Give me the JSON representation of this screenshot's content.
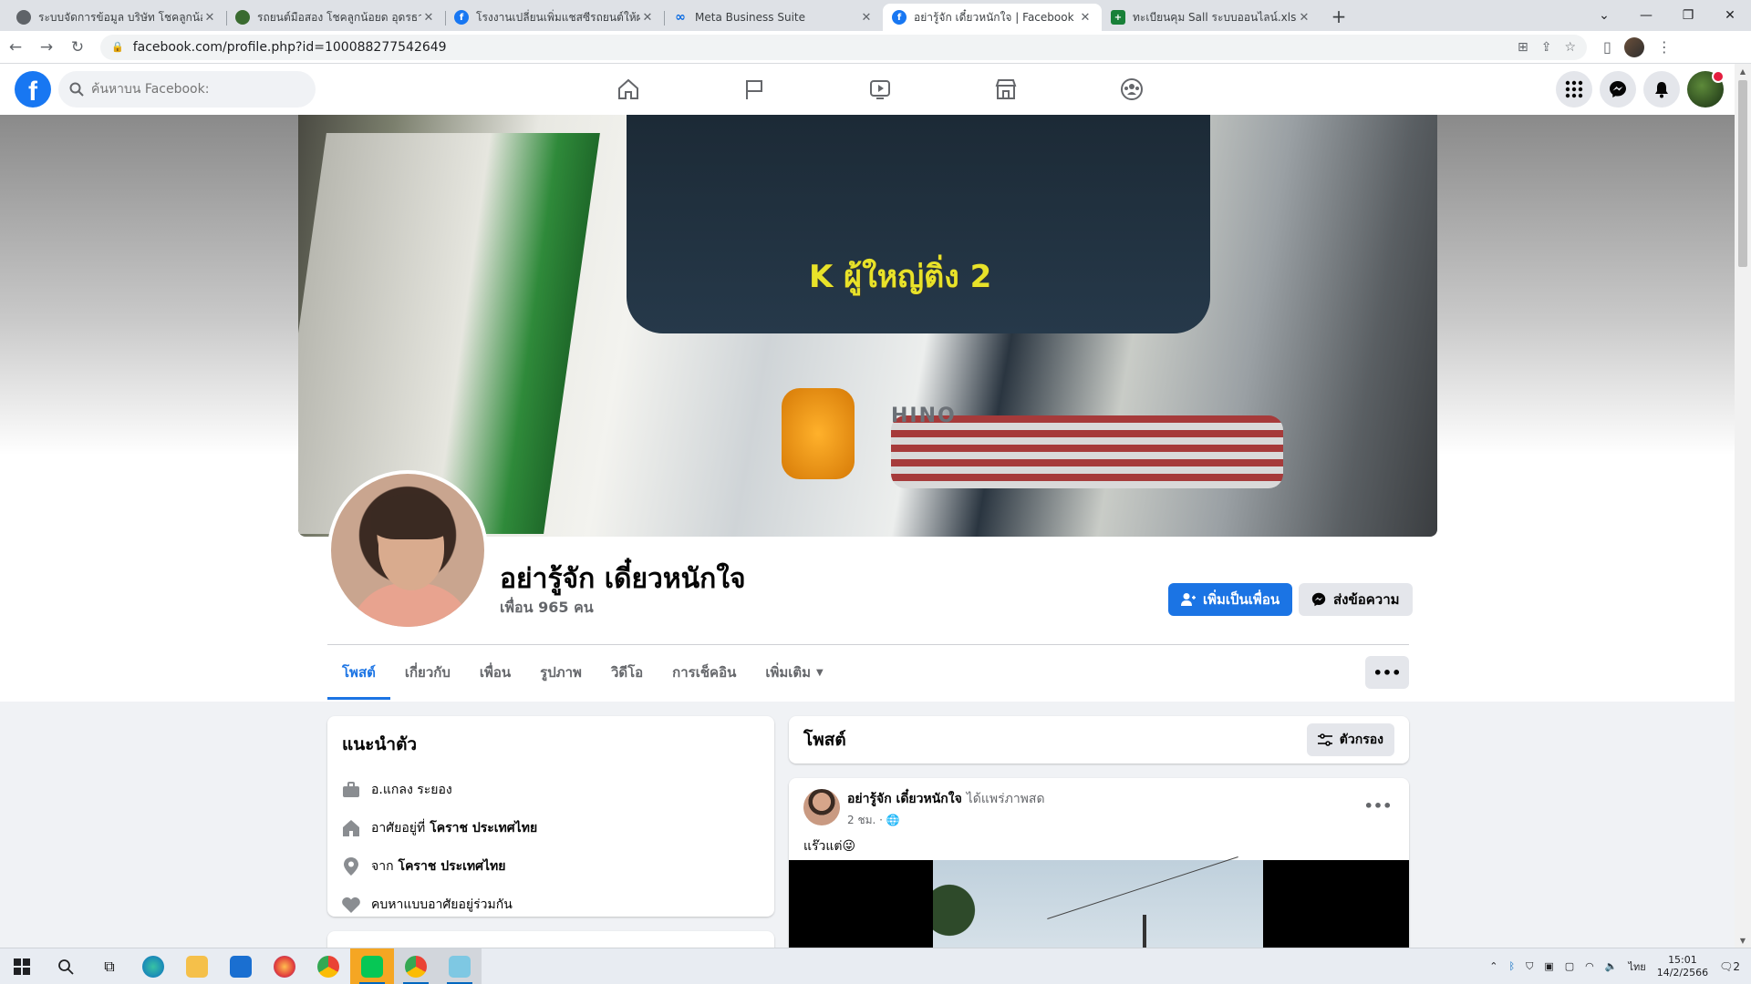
{
  "browser": {
    "tabs": [
      {
        "title": "ระบบจัดการข้อมูล บริษัท โชคลูกน้อยด ...",
        "favicon_color": "#5f6368",
        "active": false
      },
      {
        "title": "รถยนต์มือสอง โชคลูกน้อยด อุดรธานี",
        "favicon_color": "#3a6b30",
        "active": false
      },
      {
        "title": "โรงงานเปลี่ยนเพิ่มแชสซีรถยนต์ให้ผลัก ...",
        "favicon_color": "#1877f2",
        "active": false
      },
      {
        "title": "Meta Business Suite",
        "favicon_color": "#0668e1",
        "active": false
      },
      {
        "title": "อย่ารู้จัก เดี๋ยวหนักใจ | Facebook",
        "favicon_color": "#1877f2",
        "active": true
      },
      {
        "title": "ทะเบียนคุม Sall ระบบออนไลน์.xlsx - G...",
        "favicon_color": "#188038",
        "active": false
      }
    ],
    "url": "facebook.com/profile.php?id=100088277542649"
  },
  "fb": {
    "logo": "f",
    "search_placeholder": "ค้นหาบน Facebook:",
    "nav": [
      "home-icon",
      "flag-icon",
      "video-icon",
      "marketplace-icon",
      "groups-icon"
    ],
    "right": [
      "apps-grid-icon",
      "messenger-icon",
      "bell-icon"
    ]
  },
  "cover": {
    "sticker_text": "K ผู้ใหญ่ติ่ง 2",
    "brand": "HINO"
  },
  "profile": {
    "name": "อย่ารู้จัก เดี๋ยวหนักใจ",
    "friends": "เพื่อน 965 คน",
    "add_friend": "เพิ่มเป็นเพื่อน",
    "message": "ส่งข้อความ"
  },
  "tabs": [
    "โพสต์",
    "เกี่ยวกับ",
    "เพื่อน",
    "รูปภาพ",
    "วิดีโอ",
    "การเช็คอิน",
    "เพิ่มเติม"
  ],
  "intro": {
    "title": "แนะนำตัว",
    "rows": [
      {
        "icon": "work-icon",
        "prefix": "อ.แกลง ระยอง",
        "bold": ""
      },
      {
        "icon": "home-icon",
        "prefix": "อาศัยอยู่ที่",
        "bold": "โคราช ประเทศไทย"
      },
      {
        "icon": "location-icon",
        "prefix": "จาก",
        "bold": "โคราช ประเทศไทย"
      },
      {
        "icon": "heart-icon",
        "prefix": "คบหาแบบอาศัยอยู่ร่วมกัน",
        "bold": ""
      }
    ]
  },
  "posts": {
    "title": "โพสต์",
    "filter": "ตัวกรอง",
    "item": {
      "author": "อย่ารู้จัก เดี๋ยวหนักใจ",
      "action": "ได้แพร่ภาพสด",
      "time": "2 ชม. ·",
      "text": "แร๊วแต่😜"
    }
  },
  "taskbar": {
    "lang": "ไทย",
    "time": "15:01",
    "date": "14/2/2566",
    "notification_count": "2"
  }
}
